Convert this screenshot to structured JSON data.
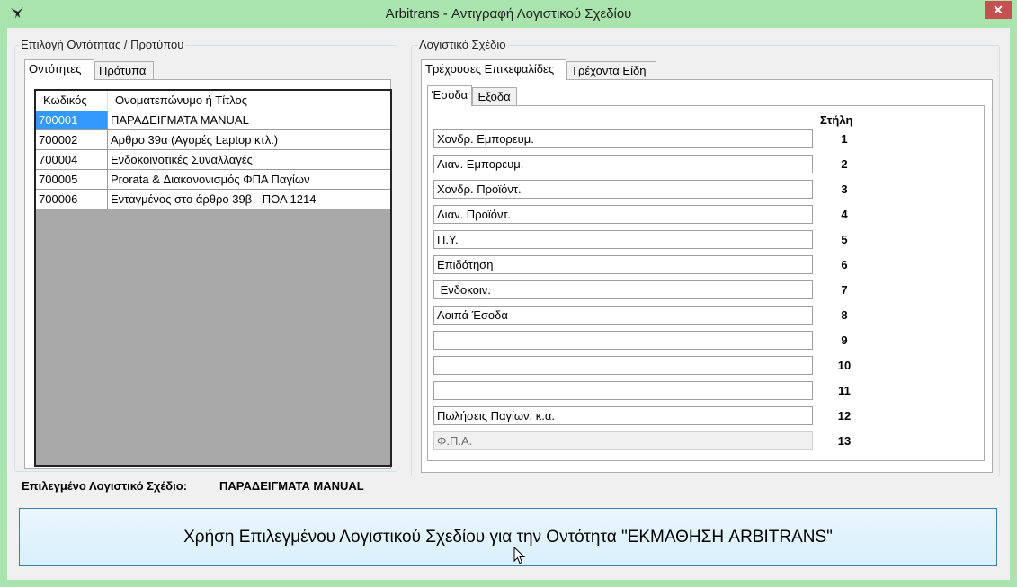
{
  "window": {
    "title": "Arbitrans - Αντιγραφή Λογιστικού Σχεδίου",
    "close_label": "✕"
  },
  "left": {
    "legend": "Επιλογή Οντότητας / Προτύπου",
    "tabs": [
      {
        "label": "Οντότητες"
      },
      {
        "label": "Πρότυπα"
      }
    ],
    "grid": {
      "headers": [
        "Κωδικός",
        "Ονοματεπώνυμο ή Τίτλος"
      ],
      "rows": [
        {
          "code": "700001",
          "name": "ΠΑΡΑΔΕΙΓΜΑΤΑ MANUAL"
        },
        {
          "code": "700002",
          "name": "Αρθρο 39α (Αγορές Laptop κτλ.)"
        },
        {
          "code": "700004",
          "name": "Ενδοκοινοτικές Συναλλαγές"
        },
        {
          "code": "700005",
          "name": "Prorata & Διακανονισμός ΦΠΑ Παγίων"
        },
        {
          "code": "700006",
          "name": "Ενταγμένος στο άρθρο 39β - ΠΟΛ 1214"
        }
      ]
    }
  },
  "right": {
    "legend": "Λογιστικό Σχέδιο",
    "tabs": [
      {
        "label": "Τρέχουσες Επικεφαλίδες"
      },
      {
        "label": "Τρέχοντα Είδη"
      }
    ],
    "subtabs": [
      {
        "label": "Έσοδα"
      },
      {
        "label": "Έξοδα"
      }
    ],
    "column_header": "Στήλη",
    "columns": [
      {
        "value": "Χονδρ. Εμπορευμ.",
        "num": "1"
      },
      {
        "value": "Λιαν. Εμπορευμ.",
        "num": "2"
      },
      {
        "value": "Χονδρ. Προϊόντ.",
        "num": "3"
      },
      {
        "value": "Λιαν. Προϊόντ.",
        "num": "4"
      },
      {
        "value": "Π.Υ.",
        "num": "5"
      },
      {
        "value": "Επιδότηση",
        "num": "6"
      },
      {
        "value": " Ενδοκοιν.",
        "num": "7"
      },
      {
        "value": "Λοιπά Έσοδα",
        "num": "8"
      },
      {
        "value": "",
        "num": "9"
      },
      {
        "value": "",
        "num": "10"
      },
      {
        "value": "",
        "num": "11"
      },
      {
        "value": "Πωλήσεις Παγίων, κ.α.",
        "num": "12"
      },
      {
        "value": "Φ.Π.Α.",
        "num": "13"
      }
    ]
  },
  "selected": {
    "label": "Επιλεγμένο Λογιστικό Σχέδιο:",
    "value": "ΠΑΡΑΔΕΙΓΜΑΤΑ MANUAL"
  },
  "apply_button": "Χρήση Επιλεγμένου Λογιστικού Σχεδίου για την Οντότητα \"ΕΚΜΑΘΗΣΗ  ARBITRANS\""
}
